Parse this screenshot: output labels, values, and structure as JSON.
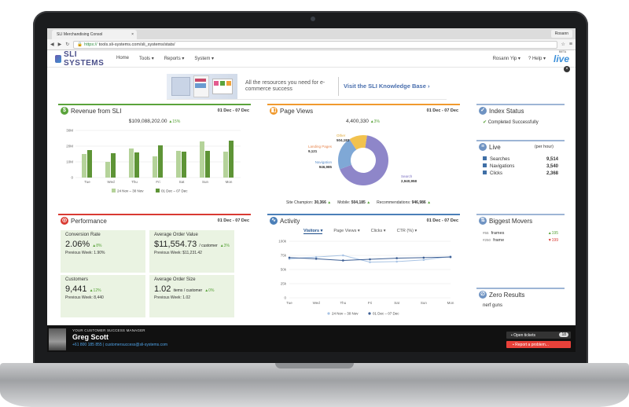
{
  "browser": {
    "tab_title": "SLI Merchandising Consol",
    "tab_close": "×",
    "profile": "Rosann",
    "url_scheme": "https://",
    "url_rest": "tools.sli-systems.com/sli_systems/stats/"
  },
  "app": {
    "logo": "SLI SYSTEMS",
    "nav": [
      "Home",
      "Tools ▾",
      "Reports ▾",
      "System ▾"
    ],
    "user": "Rosann Yip ▾",
    "help": "? Help ▾",
    "live_logo": "live",
    "live_beta": "BETA",
    "close": "×"
  },
  "banner": {
    "text": "All the resources you need for e-commerce success",
    "link": "Visit the SLI Knowledge Base"
  },
  "revenue": {
    "title": "Revenue from SLI",
    "date": "01 Dec - 07 Dec",
    "total": "$109,088,202.00",
    "change": "▲15%",
    "chart_data": {
      "type": "bar",
      "categories": [
        "Tue",
        "Wed",
        "Thu",
        "Fri",
        "Sat",
        "Sun",
        "Mon"
      ],
      "series": [
        {
          "name": "24 Nov – 30 Nov",
          "values": [
            15,
            10,
            18.5,
            13.5,
            17,
            23,
            16.5
          ],
          "color": "#b5d39a"
        },
        {
          "name": "01 Dec – 07 Dec",
          "values": [
            17.5,
            15.5,
            16,
            20.5,
            16.5,
            17,
            23.5
          ],
          "color": "#5e9436"
        }
      ],
      "yticks": [
        "0",
        "10M",
        "20M",
        "30M"
      ],
      "ylim": [
        0,
        30
      ]
    }
  },
  "pageviews": {
    "title": "Page Views",
    "date": "01 Dec - 07 Dec",
    "total": "4,400,330",
    "change": "▲3%",
    "chart_data": {
      "type": "pie",
      "slices": [
        {
          "label": "Search",
          "value": 2940958,
          "display": "2,940,958",
          "color": "#8e86c9"
        },
        {
          "label": "Navigation",
          "value": 946985,
          "display": "946,985",
          "color": "#7fa8d6"
        },
        {
          "label": "Landing Pages",
          "value": 9121,
          "display": "9,121",
          "color": "#e8864e"
        },
        {
          "label": "Other",
          "value": 504183,
          "display": "504,183",
          "color": "#f2c24e"
        }
      ]
    },
    "footer": [
      {
        "label": "Site Champion: ",
        "value": "30,366"
      },
      {
        "label": "Mobile: ",
        "value": "504,185"
      },
      {
        "label": "Recommendations: ",
        "value": "946,986"
      }
    ]
  },
  "index_status": {
    "title": "Index Status",
    "status": "Completed Successfully"
  },
  "live": {
    "title": "Live",
    "unit": "(per hour)",
    "rows": [
      {
        "label": "Searches",
        "value": "9,514",
        "color": "#3f6fa6"
      },
      {
        "label": "Navigations",
        "value": "3,540",
        "color": "#3f6fa6"
      },
      {
        "label": "Clicks",
        "value": "2,368",
        "color": "#3f6fa6"
      }
    ]
  },
  "performance": {
    "title": "Performance",
    "date": "01 Dec - 07 Dec",
    "cells": [
      {
        "label": "Conversion Rate",
        "value": "2.06%",
        "change": "▲8%",
        "suffix": "",
        "prev": "Previous Week: 1.90%"
      },
      {
        "label": "Average Order Value",
        "value": "$11,554.73",
        "change": "▲3%",
        "suffix": "/ customer",
        "prev": "Previous Week: $11,231.42"
      },
      {
        "label": "Customers",
        "value": "9,441",
        "change": "▲12%",
        "suffix": "",
        "prev": "Previous Week: 8,440"
      },
      {
        "label": "Average Order Size",
        "value": "1.02",
        "change": "▲0%",
        "suffix": "items / customer",
        "prev": "Previous Week: 1.02"
      }
    ]
  },
  "activity": {
    "title": "Activity",
    "date": "01 Dec - 07 Dec",
    "tabs": [
      "Visitors ▾",
      "Page Views ▾",
      "Clicks ▾",
      "CTR (%) ▾"
    ],
    "chart_data": {
      "type": "line",
      "categories": [
        "Tue",
        "Wed",
        "Thu",
        "Fri",
        "Sat",
        "Sun",
        "Mon"
      ],
      "yticks": [
        "0",
        "25k",
        "50k",
        "75k",
        "100k"
      ],
      "ylim": [
        0,
        100
      ],
      "series": [
        {
          "name": "24 Nov – 30 Nov",
          "values": [
            69,
            72,
            75,
            63,
            64,
            67,
            73
          ],
          "color": "#a9c4e4"
        },
        {
          "name": "01 Dec – 07 Dec",
          "values": [
            71,
            69,
            66,
            68,
            70,
            71,
            72
          ],
          "color": "#3d5f94"
        }
      ]
    }
  },
  "movers": {
    "title": "Biggest Movers",
    "rows": [
      {
        "rank": "#55",
        "term": "frames",
        "change": "▲195"
      },
      {
        "rank": "#250",
        "term": "frame",
        "change": "▼199"
      }
    ]
  },
  "zero": {
    "title": "Zero Results",
    "term": "nerf guns"
  },
  "csm": {
    "title": "YOUR CUSTOMER SUCCESS MANAGER",
    "name": "Greg Scott",
    "contact": "+61 800 185 855  |  customersuccess@sli-systems.com",
    "open_tickets": "▪ Open tickets",
    "tickets_count": "18",
    "report": "▪ Report a problem..."
  }
}
